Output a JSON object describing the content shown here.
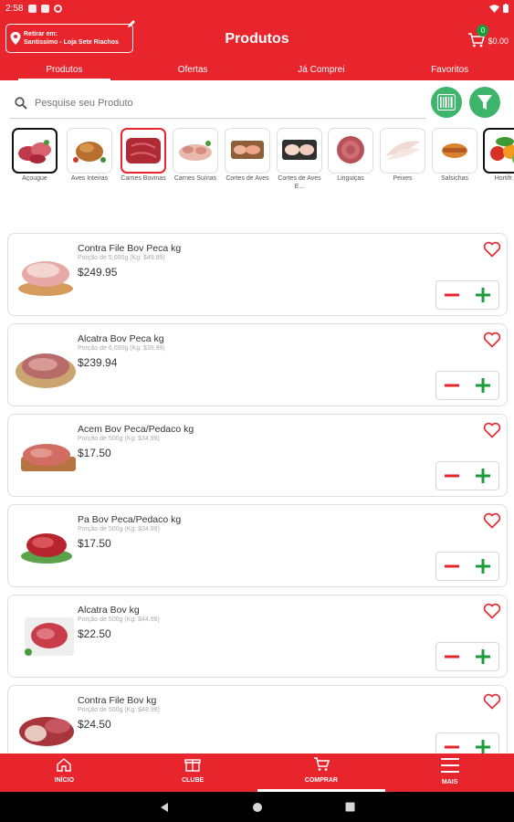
{
  "status": {
    "time": "2:58"
  },
  "header": {
    "pickup_line1": "Retirar em:",
    "pickup_line2": "Santissimo - Loja Sete Riachos",
    "title": "Produtos",
    "cart_count": "0",
    "cart_total": "$0.00"
  },
  "tabs": [
    "Produtos",
    "Ofertas",
    "Já Comprei",
    "Favoritos"
  ],
  "search": {
    "placeholder": "Pesquise seu Produto"
  },
  "categories": [
    {
      "label": "Açougue"
    },
    {
      "label": "Aves Inteiras"
    },
    {
      "label": "Carnes Bovinas"
    },
    {
      "label": "Carnes Suínas"
    },
    {
      "label": "Cortes de Aves"
    },
    {
      "label": "Cortes de Aves E..."
    },
    {
      "label": "Linguiças"
    },
    {
      "label": "Peixes"
    },
    {
      "label": "Salsichas"
    },
    {
      "label": "Hortifr..."
    }
  ],
  "products": [
    {
      "name": "Contra File Bov Peca kg",
      "portion": "Porção de 5,000g (Kg: $49.99)",
      "price": "$249.95"
    },
    {
      "name": "Alcatra Bov Peca kg",
      "portion": "Porção de 6,000g (Kg: $39.99)",
      "price": "$239.94"
    },
    {
      "name": "Acem Bov Peca/Pedaco kg",
      "portion": "Porção de 500g (Kg: $34.99)",
      "price": "$17.50"
    },
    {
      "name": "Pa Bov Peca/Pedaco kg",
      "portion": "Porção de 500g (Kg: $34.99)",
      "price": "$17.50"
    },
    {
      "name": "Alcatra Bov kg",
      "portion": "Porção de 500g (Kg: $44.99)",
      "price": "$22.50"
    },
    {
      "name": "Contra File Bov kg",
      "portion": "Porção de 500g (Kg: $48.99)",
      "price": "$24.50"
    }
  ],
  "bottom_nav": [
    "INÍCIO",
    "CLUBE",
    "COMPRAR",
    "MAIS"
  ],
  "colors": {
    "brand": "#e8242c",
    "accent_green": "#3db56b",
    "plus_green": "#1a9c3c"
  }
}
